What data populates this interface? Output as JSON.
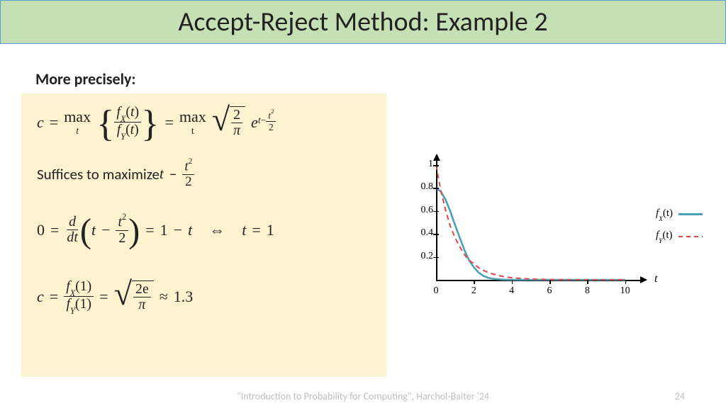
{
  "title": "Accept-Reject Method: Example 2",
  "subheading": "More precisely:",
  "math": {
    "line1": {
      "c": "c",
      "eq": "=",
      "max1": "max",
      "sub_t1": "t",
      "fx": "f",
      "x": "X",
      "t": "t",
      "fy": "f",
      "y": "Y",
      "max2": "max",
      "sub_t2": "t",
      "two": "2",
      "pi": "π",
      "e": "e",
      "exp_t": "t",
      "minus": "−",
      "t2": "t",
      "sq": "2",
      "half": "2"
    },
    "line2": {
      "text": "Suffices to maximize ",
      "t": "t",
      "minus": "−",
      "t2": "t",
      "sq": "2",
      "two": "2"
    },
    "line3": {
      "zero": "0",
      "eq": "=",
      "d": "d",
      "dt": "dt",
      "t": "t",
      "minus": "−",
      "t2": "t",
      "sq": "2",
      "two": "2",
      "eq2": "=",
      "one": "1",
      "minus2": "−",
      "t_rhs": "t",
      "iff": "⇔",
      "t_sol": "t",
      "eq3": "=",
      "one2": "1"
    },
    "line4": {
      "c": "c",
      "eq": "=",
      "fx": "f",
      "x": "X",
      "one_a": "1",
      "fy": "f",
      "y": "Y",
      "one_b": "1",
      "eq2": "=",
      "two_e": "2e",
      "pi": "π",
      "approx": "≈",
      "val": "1.3"
    }
  },
  "chart_data": {
    "type": "line",
    "xlabel": "t",
    "ylabel": "",
    "xlim": [
      0,
      10.5
    ],
    "ylim": [
      0,
      1.05
    ],
    "xticks": [
      0,
      2,
      4,
      6,
      8,
      10
    ],
    "yticks": [
      0.2,
      0.4,
      0.6,
      0.8,
      1
    ],
    "series": [
      {
        "name": "f_X(t)",
        "style": "solid",
        "color": "#4aa0b5",
        "x": [
          0,
          0.25,
          0.5,
          0.75,
          1.0,
          1.25,
          1.5,
          1.75,
          2.0,
          2.25,
          2.5,
          2.75,
          3.0,
          3.5,
          4.0,
          5.0,
          6.0,
          8.0,
          10.0
        ],
        "values": [
          0.8,
          0.77,
          0.7,
          0.6,
          0.48,
          0.37,
          0.26,
          0.17,
          0.11,
          0.063,
          0.035,
          0.018,
          0.009,
          0.002,
          0.0003,
          1e-05,
          0,
          0,
          0
        ]
      },
      {
        "name": "f_Y(t)",
        "style": "dashed",
        "color": "#d94a4a",
        "x": [
          0,
          0.25,
          0.5,
          0.75,
          1.0,
          1.25,
          1.5,
          1.75,
          2.0,
          2.25,
          2.5,
          2.75,
          3.0,
          3.5,
          4.0,
          5.0,
          6.0,
          8.0,
          10.0
        ],
        "values": [
          1.0,
          0.78,
          0.61,
          0.47,
          0.37,
          0.29,
          0.22,
          0.17,
          0.14,
          0.105,
          0.082,
          0.064,
          0.05,
          0.03,
          0.018,
          0.007,
          0.002,
          0.0003,
          5e-05
        ]
      }
    ]
  },
  "legend": {
    "fx": "f",
    "x": "X",
    "t": "(t)",
    "fy": "f",
    "y": "Y"
  },
  "footer": "\"Introduction to Probability for Computing\", Harchol-Balter '24",
  "page": "24"
}
